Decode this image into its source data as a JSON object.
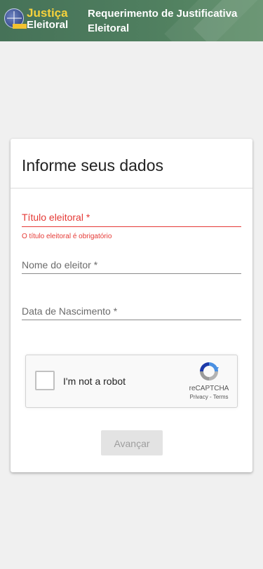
{
  "header": {
    "logo_line1": "Justiça",
    "logo_line2": "Eleitoral",
    "title": "Requerimento de Justificativa Eleitoral"
  },
  "card": {
    "title": "Informe seus dados"
  },
  "form": {
    "titulo": {
      "label": "Título eleitoral *",
      "value": "",
      "error": "O título eleitoral é obrigatório"
    },
    "nome": {
      "label": "Nome do eleitor *",
      "value": ""
    },
    "nascimento": {
      "label": "Data de Nascimento *",
      "value": ""
    }
  },
  "captcha": {
    "label": "I'm not a robot",
    "brand": "reCAPTCHA",
    "privacy": "Privacy",
    "separator": " - ",
    "terms": "Terms",
    "checked": false
  },
  "actions": {
    "submit_label": "Avançar",
    "submit_enabled": false
  },
  "colors": {
    "header_bg": "#4e7d5d",
    "error": "#e53935",
    "logo_yellow": "#f6d23c",
    "page_bg": "#f0f0f0"
  }
}
